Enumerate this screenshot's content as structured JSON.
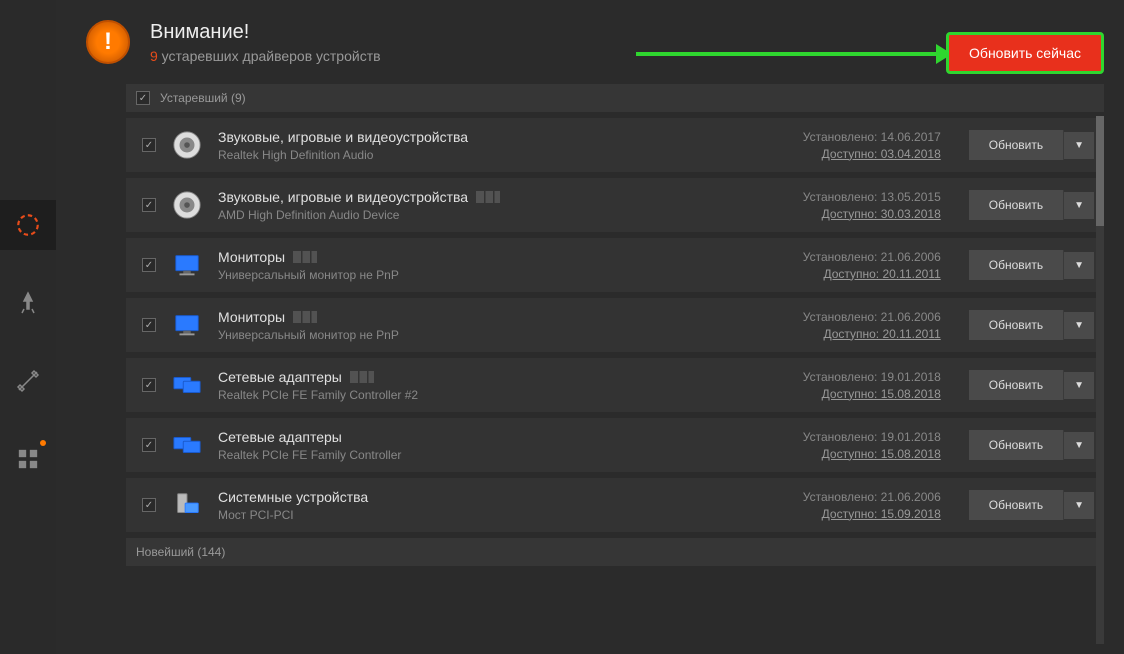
{
  "header": {
    "title": "Внимание!",
    "count": "9",
    "subtitle_rest": " устаревших драйверов устройств",
    "update_now": "Обновить сейчас"
  },
  "labels": {
    "installed": "Установлено: ",
    "available": "Доступно: ",
    "update": "Обновить"
  },
  "section_outdated": {
    "label": "Устаревший (9)"
  },
  "section_latest": {
    "label": "Новейший (144)"
  },
  "drivers": [
    {
      "category": "Звуковые, игровые и видеоустройства",
      "name": "Realtek High Definition Audio",
      "installed": "14.06.2017",
      "available": "03.04.2018",
      "icon": "speaker",
      "signal": false
    },
    {
      "category": "Звуковые, игровые и видеоустройства",
      "name": "AMD High Definition Audio Device",
      "installed": "13.05.2015",
      "available": "30.03.2018",
      "icon": "speaker",
      "signal": true
    },
    {
      "category": "Мониторы",
      "name": "Универсальный монитор не PnP",
      "installed": "21.06.2006",
      "available": "20.11.2011",
      "icon": "monitor",
      "signal": true
    },
    {
      "category": "Мониторы",
      "name": "Универсальный монитор не PnP",
      "installed": "21.06.2006",
      "available": "20.11.2011",
      "icon": "monitor",
      "signal": true
    },
    {
      "category": "Сетевые адаптеры",
      "name": "Realtek PCIe FE Family Controller #2",
      "installed": "19.01.2018",
      "available": "15.08.2018",
      "icon": "network",
      "signal": true
    },
    {
      "category": "Сетевые адаптеры",
      "name": "Realtek PCIe FE Family Controller",
      "installed": "19.01.2018",
      "available": "15.08.2018",
      "icon": "network",
      "signal": false
    },
    {
      "category": "Системные устройства",
      "name": "Мост PCI-PCI",
      "installed": "21.06.2006",
      "available": "15.09.2018",
      "icon": "system",
      "signal": false
    }
  ]
}
